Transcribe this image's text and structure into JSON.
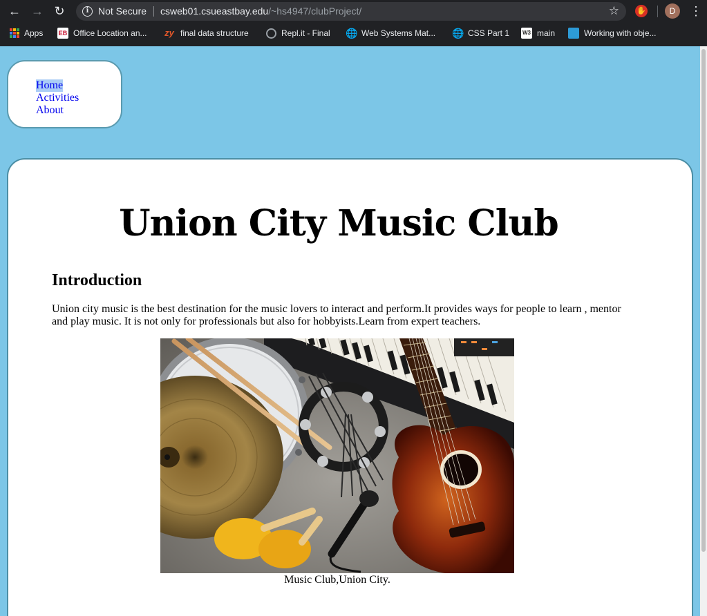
{
  "browser": {
    "security_label": "Not Secure",
    "url_host": "csweb01.csueastbay.edu",
    "url_path": "/~hs4947/clubProject/",
    "profile_initial": "D",
    "bookmarks": [
      {
        "label": "Apps",
        "icon": "apps-grid-icon"
      },
      {
        "label": "Office Location an...",
        "icon": "eb-logo-icon",
        "icon_text": "EB"
      },
      {
        "label": "final data structure",
        "icon": "zy-logo-icon",
        "icon_text": "zy"
      },
      {
        "label": "Repl.it - Final",
        "icon": "replit-icon"
      },
      {
        "label": "Web Systems Mat...",
        "icon": "globe-icon"
      },
      {
        "label": "CSS Part 1",
        "icon": "globe-icon"
      },
      {
        "label": "main",
        "icon": "w3-logo-icon",
        "icon_text": "W3"
      },
      {
        "label": "Working with obje...",
        "icon": "book-icon"
      }
    ]
  },
  "nav": {
    "items": [
      {
        "label": "Home",
        "selected": true
      },
      {
        "label": "Activities",
        "selected": false
      },
      {
        "label": "About",
        "selected": false
      }
    ]
  },
  "main": {
    "title": "Union City Music Club",
    "section_heading": "Introduction",
    "intro_text": "Union city music is the best destination for the music lovers to interact and perform.It provides ways for people to learn , mentor and play music. It is not only for professionals but also for hobbyists.Learn from expert teachers.",
    "image_caption": "Music Club,Union City."
  },
  "colors": {
    "page_background": "#7cc6e7",
    "card_border": "#4b8ea5",
    "link": "#0000ee",
    "selection": "#abcdf6"
  }
}
